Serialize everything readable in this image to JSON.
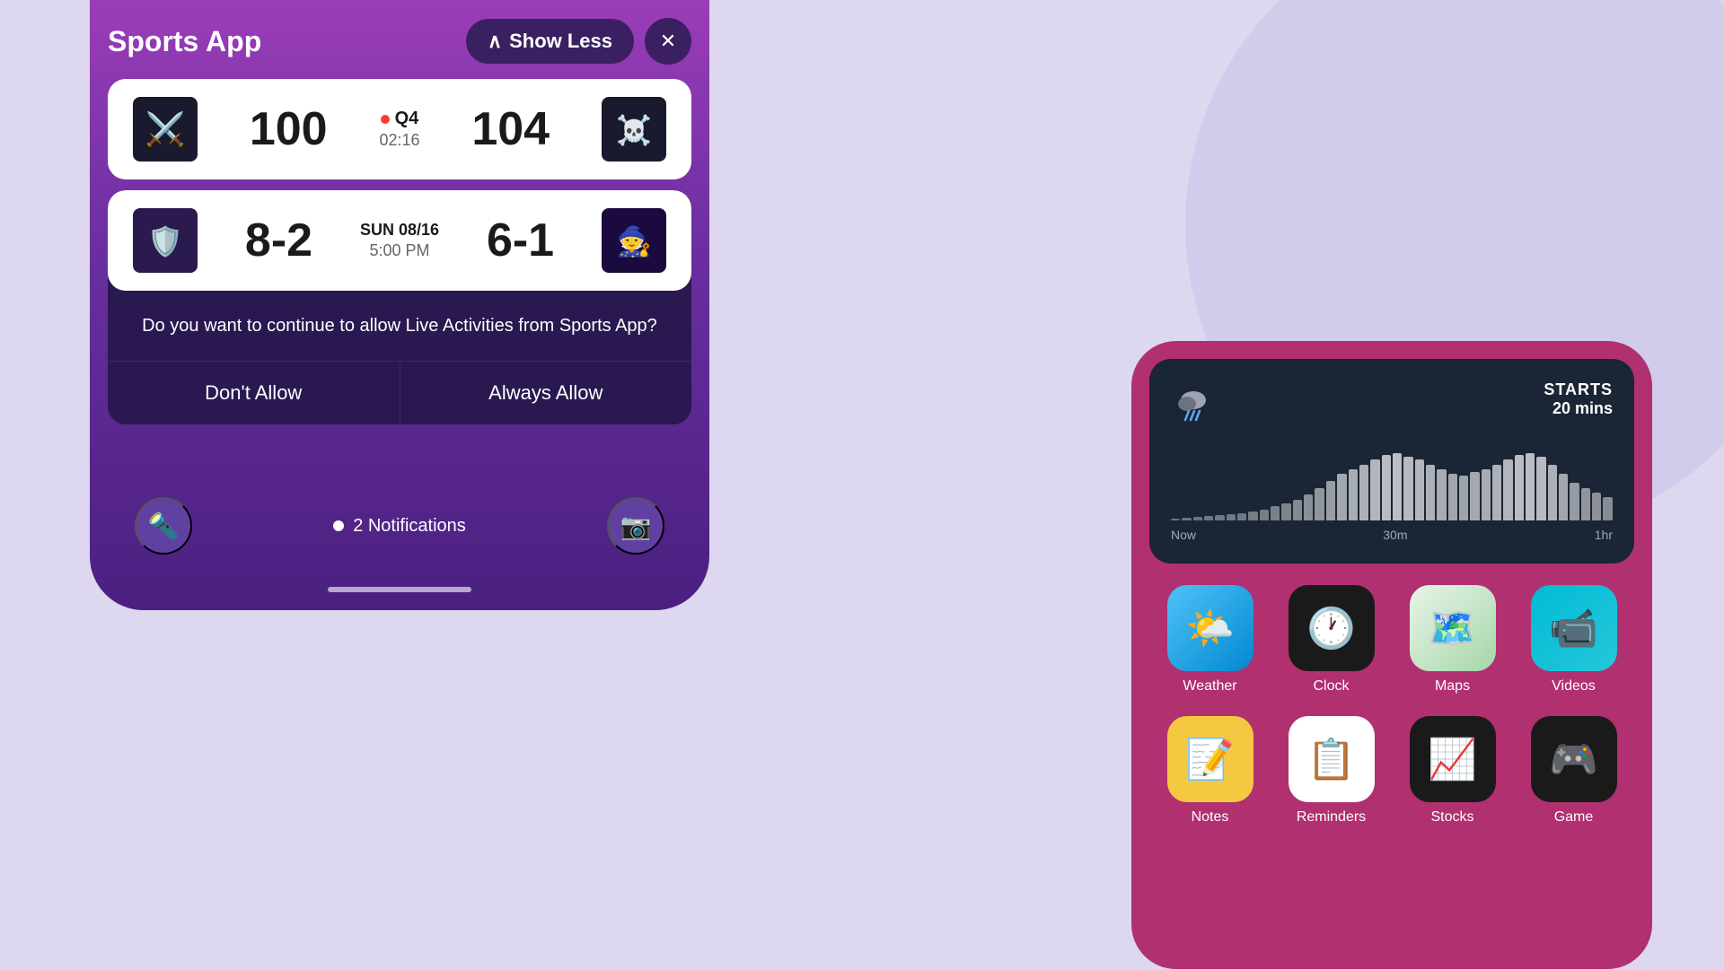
{
  "background": {
    "color": "#ddd8f0"
  },
  "phone_left": {
    "title": "Sports App",
    "show_less_label": "Show Less",
    "close_label": "✕",
    "game1": {
      "team1_name": "Knight",
      "team1_score": "100",
      "team1_emoji": "⚔️",
      "status": "Q4",
      "time": "02:16",
      "live": true,
      "team2_score": "104",
      "team2_name": "Pirates",
      "team2_emoji": "🏴‍☠️"
    },
    "game2": {
      "team1_name": "Vikings",
      "team1_score": "8-2",
      "team1_emoji": "🛡️",
      "date": "SUN 08/16",
      "time": "5:00 PM",
      "team2_score": "6-1",
      "team2_name": "Wizards",
      "team2_emoji": "🧙"
    },
    "permission": {
      "message": "Do you want to continue to allow Live Activities from Sports App?",
      "dont_allow": "Don't Allow",
      "always_allow": "Always Allow"
    },
    "notifications": "2 Notifications",
    "home_indicator": true
  },
  "phone_right": {
    "weather_widget": {
      "starts_label": "STARTS",
      "starts_time": "20 mins",
      "time_labels": [
        "Now",
        "30m",
        "1hr"
      ],
      "bars": [
        2,
        3,
        4,
        5,
        6,
        7,
        8,
        10,
        12,
        15,
        18,
        22,
        28,
        35,
        42,
        50,
        55,
        60,
        65,
        70,
        72,
        68,
        65,
        60,
        55,
        50,
        48,
        52,
        55,
        60,
        65,
        70,
        72,
        68,
        60,
        50,
        40,
        35,
        30,
        25
      ]
    },
    "apps_row1": [
      {
        "label": "Weather",
        "emoji": "🌤️",
        "style": "weather"
      },
      {
        "label": "Clock",
        "emoji": "🕐",
        "style": "clock"
      },
      {
        "label": "Maps",
        "emoji": "🗺️",
        "style": "maps"
      },
      {
        "label": "Videos",
        "emoji": "📹",
        "style": "videos"
      }
    ],
    "apps_row2": [
      {
        "label": "Notes",
        "emoji": "📝",
        "style": "notes"
      },
      {
        "label": "Reminders",
        "emoji": "📋",
        "style": "reminders"
      },
      {
        "label": "Stocks",
        "emoji": "📈",
        "style": "stocks"
      },
      {
        "label": "Game",
        "emoji": "🎮",
        "style": "game"
      }
    ]
  }
}
